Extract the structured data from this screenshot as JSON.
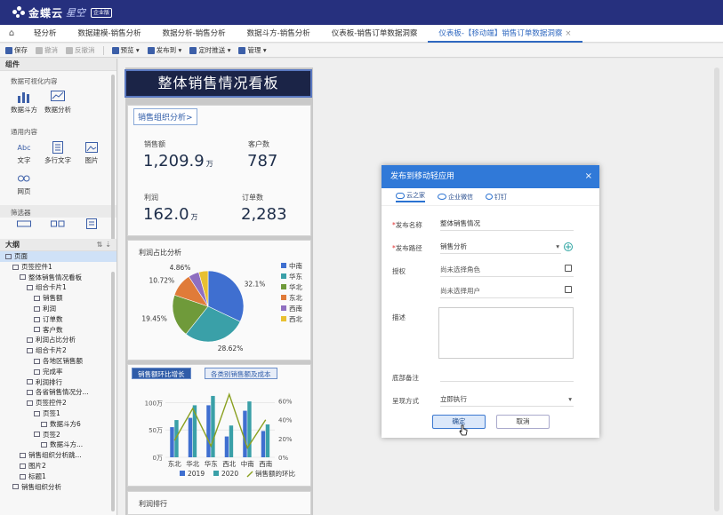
{
  "app": {
    "brand": "金蝶云",
    "brand_sub": "星空",
    "badge": "企业版"
  },
  "tabs": [
    {
      "label": "轻分析",
      "active": false
    },
    {
      "label": "数据建模-销售分析",
      "active": false
    },
    {
      "label": "数据分析-销售分析",
      "active": false
    },
    {
      "label": "数据斗方-销售分析",
      "active": false
    },
    {
      "label": "仪表板-销售订单数据洞察",
      "active": false
    },
    {
      "label": "仪表板-【移动端】销售订单数据洞察",
      "active": true,
      "close": "×"
    }
  ],
  "toolbar": {
    "save": "保存",
    "undo": "撤消",
    "redo": "反撤消",
    "preview": "预览",
    "publish": "发布到",
    "schedule": "定时推送",
    "manage": "管理"
  },
  "components": {
    "header": "组件",
    "section_viz": "数据可视化内容",
    "viz_items": [
      "数据斗方",
      "数据分析"
    ],
    "section_general": "通用内容",
    "general_items": [
      "文字",
      "多行文字",
      "图片",
      "网页"
    ],
    "section_filter": "筛选器",
    "text_glyph": "Abc"
  },
  "outline": {
    "header": "大纲",
    "nodes": [
      {
        "label": "页面",
        "level": 0,
        "selected": true
      },
      {
        "label": "页签控件1",
        "level": 1
      },
      {
        "label": "整体销售情况看板",
        "level": 2
      },
      {
        "label": "组合卡片1",
        "level": 3
      },
      {
        "label": "销售额",
        "level": 4
      },
      {
        "label": "利润",
        "level": 4
      },
      {
        "label": "订单数",
        "level": 4
      },
      {
        "label": "客户数",
        "level": 4
      },
      {
        "label": "利润占比分析",
        "level": 3
      },
      {
        "label": "组合卡片2",
        "level": 3
      },
      {
        "label": "各地区销售额",
        "level": 4
      },
      {
        "label": "完成率",
        "level": 4
      },
      {
        "label": "利润排行",
        "level": 3
      },
      {
        "label": "各省销售情况分...",
        "level": 3
      },
      {
        "label": "页签控件2",
        "level": 3
      },
      {
        "label": "页签1",
        "level": 4
      },
      {
        "label": "数据斗方6",
        "level": 5
      },
      {
        "label": "页签2",
        "level": 4
      },
      {
        "label": "数据斗方...",
        "level": 5
      },
      {
        "label": "销售组织分析跳...",
        "level": 2
      },
      {
        "label": "图片2",
        "level": 2
      },
      {
        "label": "标题1",
        "level": 2
      },
      {
        "label": "销售组织分析",
        "level": 1
      }
    ]
  },
  "dashboard": {
    "title": "整体销售情况看板",
    "org_button": "销售组织分析>",
    "kpis": [
      {
        "label": "销售额",
        "value": "1,209.9",
        "unit": "万"
      },
      {
        "label": "客户数",
        "value": "787",
        "unit": ""
      },
      {
        "label": "利润",
        "value": "162.0",
        "unit": "万"
      },
      {
        "label": "订单数",
        "value": "2,283",
        "unit": ""
      }
    ],
    "pie_title": "利润占比分析",
    "tab_active": "销售额环比增长",
    "tab_other": "各类别销售额及成本",
    "bottom_title": "利润排行"
  },
  "chart_data": [
    {
      "type": "pie",
      "title": "利润占比分析",
      "labels": [
        "中南",
        "华东",
        "华北",
        "东北",
        "西南",
        "西北"
      ],
      "values": [
        32.1,
        28.62,
        19.45,
        10.72,
        4.86,
        4.25
      ],
      "value_labels": [
        "32.1%",
        "28.62%",
        "19.45%",
        "10.72%",
        "4.86%",
        ""
      ],
      "colors": [
        "#3f6fd0",
        "#3aa0a8",
        "#6f9a3a",
        "#e07b39",
        "#8f6fc0",
        "#e8c030"
      ],
      "legend_position": "right"
    },
    {
      "type": "bar",
      "categories": [
        "东北",
        "华北",
        "华东",
        "西北",
        "中南",
        "西南"
      ],
      "series": [
        {
          "name": "2019",
          "values": [
            55,
            72,
            95,
            38,
            85,
            48
          ],
          "color": "#3f6fd0"
        },
        {
          "name": "2020",
          "values": [
            68,
            95,
            112,
            58,
            102,
            60
          ],
          "color": "#3aa0a8"
        },
        {
          "name": "销售额的环比",
          "type": "line",
          "axis": "right",
          "values": [
            18,
            52,
            12,
            67,
            10,
            40
          ],
          "color": "#8aa020"
        }
      ],
      "yticks_left": [
        "100万",
        "50万",
        "0万"
      ],
      "yticks_right": [
        "60%",
        "40%",
        "20%",
        "0%"
      ],
      "ylim_left": [
        0,
        120
      ],
      "ylim_right": [
        0,
        70
      ],
      "legend_position": "bottom"
    }
  ],
  "modal": {
    "title": "发布到移动轻应用",
    "close": "×",
    "tabs": [
      "云之家",
      "企业微信",
      "钉钉"
    ],
    "name_label": "发布名称",
    "name_value": "整体销售情况",
    "path_label": "发布路径",
    "path_value": "销售分析",
    "auth_label": "授权",
    "role_placeholder": "尚未选择角色",
    "user_placeholder": "尚未选择用户",
    "desc_label": "描述",
    "note_label": "底部备注",
    "mode_label": "呈现方式",
    "mode_value": "立即执行",
    "ok": "确定",
    "cancel": "取消"
  }
}
